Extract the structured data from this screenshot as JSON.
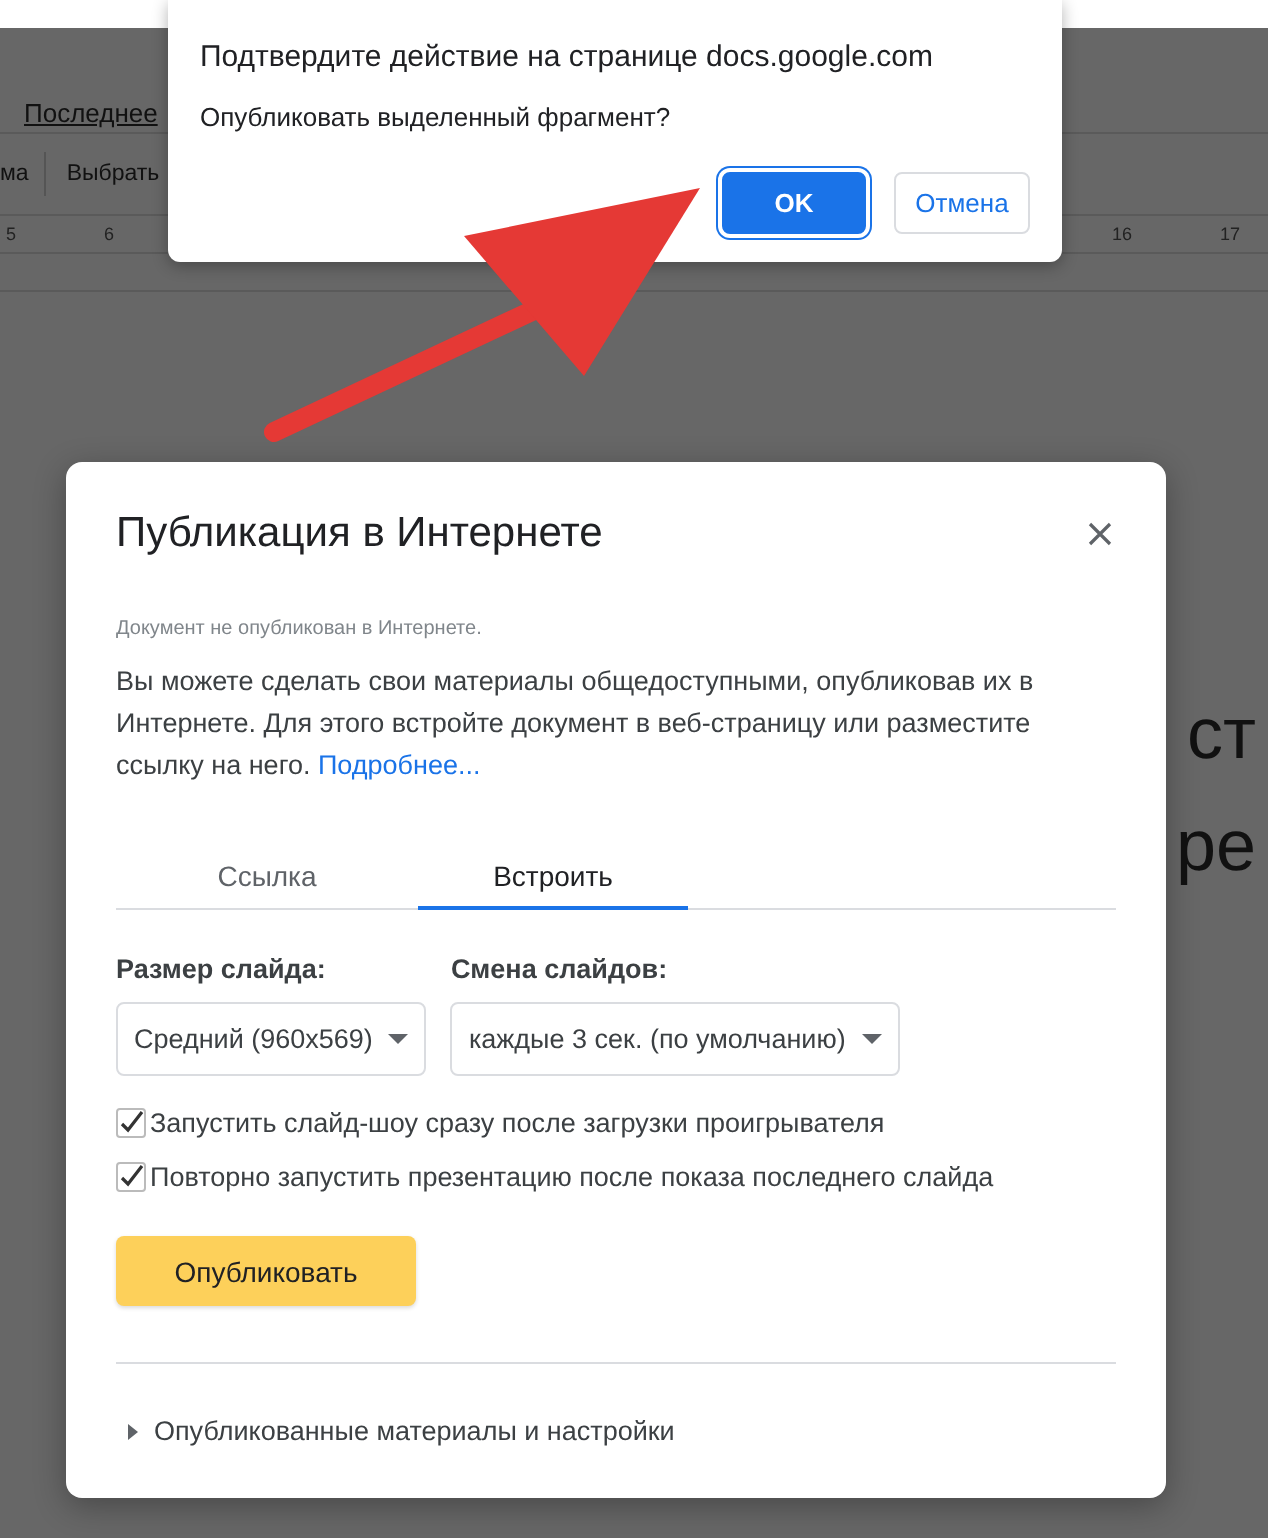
{
  "background": {
    "recent_link": "Последнее",
    "toolbar": [
      "ма",
      "Выбрать"
    ],
    "ruler": [
      "5",
      "6",
      "16",
      "17"
    ],
    "slide_text": [
      "ст",
      "ре"
    ]
  },
  "confirm": {
    "title": "Подтвердите действие на странице docs.google.com",
    "message": "Опубликовать выделенный фрагмент?",
    "buttons": [
      {
        "label": "OK",
        "kind": "primary"
      },
      {
        "label": "Отмена",
        "kind": "secondary"
      }
    ]
  },
  "dialog": {
    "title": "Публикация в Интернете",
    "status": "Документ не опубликован в Интернете.",
    "description": "Вы можете сделать свои материалы общедоступными, опубликовав их в Интернете. Для этого встройте документ в веб-страницу или разместите ссылку на него.",
    "learn_more": "Подробнее...",
    "tabs": [
      {
        "label": "Ссылка",
        "selected": false
      },
      {
        "label": "Встроить",
        "selected": true
      }
    ],
    "fields": [
      {
        "label": "Размер слайда:",
        "value": "Средний (960x569)"
      },
      {
        "label": "Смена слайдов:",
        "value": "каждые 3 сек. (по умолчанию)"
      }
    ],
    "options": [
      {
        "label": "Запустить слайд-шоу сразу после загрузки проигрывателя",
        "checked": true
      },
      {
        "label": "Повторно запустить презентацию после показа последнего слайда",
        "checked": true
      }
    ],
    "publish_button": "Опубликовать",
    "details": {
      "label": "Опубликованные материалы и настройки",
      "expanded": false
    }
  }
}
